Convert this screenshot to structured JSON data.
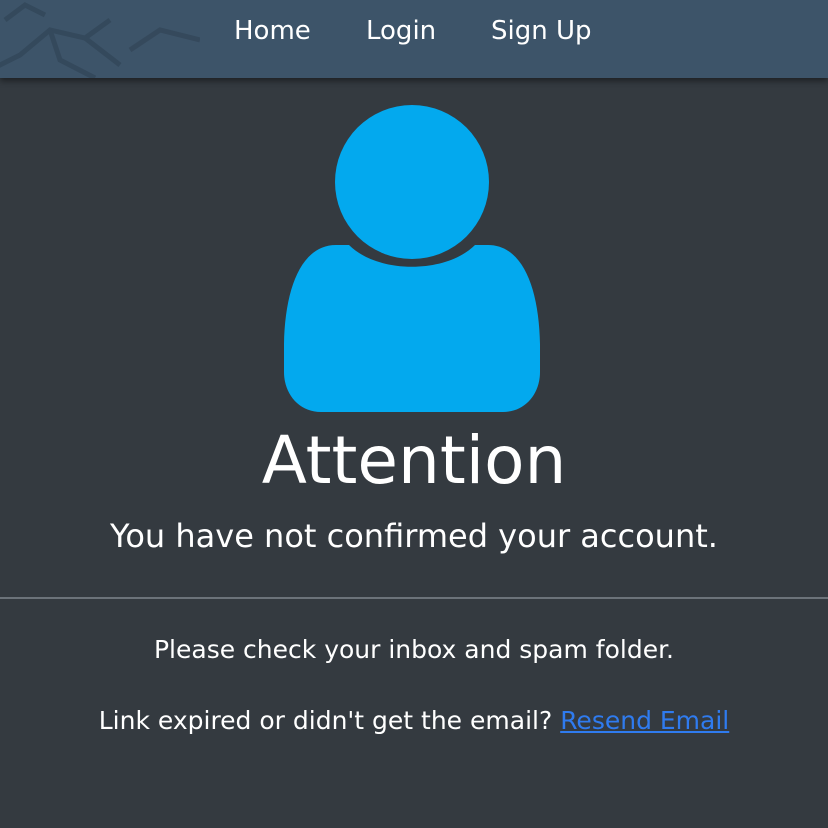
{
  "nav": {
    "items": [
      {
        "label": "Home"
      },
      {
        "label": "Login"
      },
      {
        "label": "Sign Up"
      }
    ]
  },
  "hero": {
    "icon": "user-icon",
    "icon_color": "#03a9ee",
    "title": "Attention",
    "subtitle": "You have not confirmed your account."
  },
  "message": {
    "inbox_note": "Please check your inbox and spam folder.",
    "resend_prompt": "Link expired or didn't get the email?",
    "resend_link": "Resend Email"
  },
  "colors": {
    "background": "#343a40",
    "navbar": "#3d5469",
    "link": "#2f7bef"
  }
}
